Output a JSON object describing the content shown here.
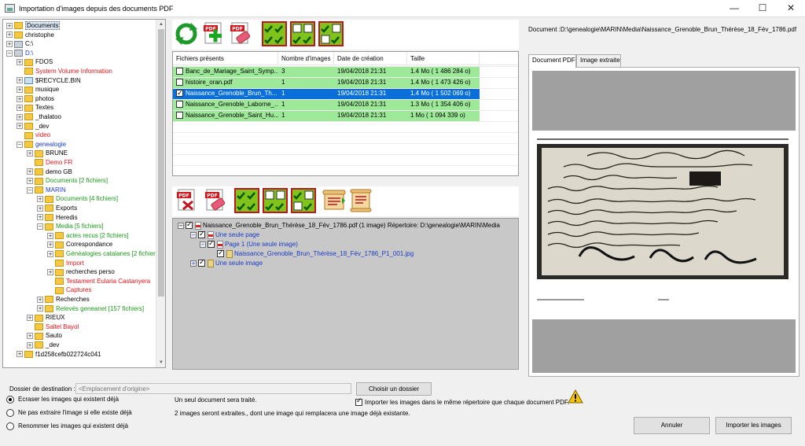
{
  "window": {
    "title": "Importation d'images depuis des documents PDF",
    "minimize": "—",
    "maximize": "☐",
    "close": "✕"
  },
  "tree": [
    {
      "label": "Documents",
      "level": 0,
      "expander": "+",
      "icon": "folder",
      "color": "black",
      "selected": true
    },
    {
      "label": "christophe",
      "level": 0,
      "expander": "+",
      "icon": "folder",
      "color": "black"
    },
    {
      "label": "C:\\",
      "level": 0,
      "expander": "+",
      "icon": "drive",
      "color": "black"
    },
    {
      "label": "D:\\",
      "level": 0,
      "expander": "−",
      "icon": "drive",
      "color": "blue"
    },
    {
      "label": "FDOS",
      "level": 1,
      "expander": "+",
      "icon": "folder",
      "color": "black"
    },
    {
      "label": "System Volume Information",
      "level": 1,
      "expander": "",
      "icon": "folder",
      "color": "red"
    },
    {
      "label": "$RECYCLE.BIN",
      "level": 1,
      "expander": "+",
      "icon": "recycle",
      "color": "black"
    },
    {
      "label": "musique",
      "level": 1,
      "expander": "+",
      "icon": "folder",
      "color": "black"
    },
    {
      "label": "photos",
      "level": 1,
      "expander": "+",
      "icon": "folder",
      "color": "black"
    },
    {
      "label": "Textes",
      "level": 1,
      "expander": "+",
      "icon": "folder",
      "color": "black"
    },
    {
      "label": "_thalatoo",
      "level": 1,
      "expander": "+",
      "icon": "folder",
      "color": "black"
    },
    {
      "label": "_dev",
      "level": 1,
      "expander": "+",
      "icon": "folder",
      "color": "black"
    },
    {
      "label": "video",
      "level": 1,
      "expander": "",
      "icon": "folder",
      "color": "red"
    },
    {
      "label": "genealogie",
      "level": 1,
      "expander": "−",
      "icon": "folder",
      "color": "blue"
    },
    {
      "label": "BRUNE",
      "level": 2,
      "expander": "+",
      "icon": "folder",
      "color": "black"
    },
    {
      "label": "Demo FR",
      "level": 2,
      "expander": "",
      "icon": "folder",
      "color": "red"
    },
    {
      "label": "demo GB",
      "level": 2,
      "expander": "+",
      "icon": "folder",
      "color": "black"
    },
    {
      "label": "Documents [2 fichiers]",
      "level": 2,
      "expander": "+",
      "icon": "folder",
      "color": "green"
    },
    {
      "label": "MARIN",
      "level": 2,
      "expander": "−",
      "icon": "folder",
      "color": "blue"
    },
    {
      "label": "Documents [4 fichiers]",
      "level": 3,
      "expander": "+",
      "icon": "folder",
      "color": "green"
    },
    {
      "label": "Exports",
      "level": 3,
      "expander": "+",
      "icon": "folder",
      "color": "black"
    },
    {
      "label": "Heredis",
      "level": 3,
      "expander": "+",
      "icon": "folder",
      "color": "black"
    },
    {
      "label": "Media [5 fichiers]",
      "level": 3,
      "expander": "−",
      "icon": "folder",
      "color": "green"
    },
    {
      "label": "actes recus [2 fichiers]",
      "level": 4,
      "expander": "+",
      "icon": "folder",
      "color": "green"
    },
    {
      "label": "Correspondance",
      "level": 4,
      "expander": "+",
      "icon": "folder",
      "color": "black"
    },
    {
      "label": "Généalogies catalanes [2 fichier",
      "level": 4,
      "expander": "+",
      "icon": "folder",
      "color": "green"
    },
    {
      "label": "Import",
      "level": 4,
      "expander": "",
      "icon": "folder",
      "color": "red"
    },
    {
      "label": "recherches perso",
      "level": 4,
      "expander": "+",
      "icon": "folder",
      "color": "black"
    },
    {
      "label": "Testament Eularia Castanyera",
      "level": 4,
      "expander": "",
      "icon": "folder",
      "color": "red"
    },
    {
      "label": "Captures",
      "level": 4,
      "expander": "",
      "icon": "folder",
      "color": "red"
    },
    {
      "label": "Recherches",
      "level": 3,
      "expander": "+",
      "icon": "folder",
      "color": "black"
    },
    {
      "label": "Relevés geneanet [157 fichiers]",
      "level": 3,
      "expander": "+",
      "icon": "folder",
      "color": "green"
    },
    {
      "label": "RIEUX",
      "level": 2,
      "expander": "+",
      "icon": "folder",
      "color": "black"
    },
    {
      "label": "Saltel Bayol",
      "level": 2,
      "expander": "",
      "icon": "folder",
      "color": "red"
    },
    {
      "label": "Sauto",
      "level": 2,
      "expander": "+",
      "icon": "folder",
      "color": "black"
    },
    {
      "label": "_dev",
      "level": 2,
      "expander": "+",
      "icon": "folder",
      "color": "black"
    },
    {
      "label": "f1d258cefb022724c041",
      "level": 1,
      "expander": "+",
      "icon": "folder",
      "color": "black"
    }
  ],
  "toolbar_top": [
    {
      "name": "refresh-icon"
    },
    {
      "name": "add-pdf-icon"
    },
    {
      "name": "pdf-eraser-icon"
    },
    {
      "name": "select-all-icon"
    },
    {
      "name": "select-none-icon"
    },
    {
      "name": "invert-selection-icon"
    }
  ],
  "toolbar_bottom": [
    {
      "name": "pdf-delete-icon"
    },
    {
      "name": "pdf-eraser-icon"
    },
    {
      "name": "select-all-icon"
    },
    {
      "name": "select-none-icon"
    },
    {
      "name": "invert-selection-icon"
    },
    {
      "name": "expand-scroll-icon"
    },
    {
      "name": "collapse-scroll-icon"
    }
  ],
  "files": {
    "headers": [
      "Fichiers présents",
      "Nombre d'images",
      "Date de création",
      "Taille"
    ],
    "rows": [
      {
        "name": "Banc_de_Mariage_Saint_Symp...",
        "count": "3",
        "date": "19/04/2018 21:31",
        "size": "1.4 Mo ( 1 486 284 o)",
        "checked": false,
        "state": "green"
      },
      {
        "name": "histoire_oran.pdf",
        "count": "1",
        "date": "19/04/2018 21:31",
        "size": "1.4 Mo ( 1 473 426 o)",
        "checked": false,
        "state": "green"
      },
      {
        "name": "Naissance_Grenoble_Brun_Th...",
        "count": "1",
        "date": "19/04/2018 21:31",
        "size": "1.4 Mo ( 1 502 069 o)",
        "checked": true,
        "state": "selected"
      },
      {
        "name": "Naissance_Grenoble_Laborne_...",
        "count": "1",
        "date": "19/04/2018 21:31",
        "size": "1.3 Mo ( 1 354 406 o)",
        "checked": false,
        "state": "green"
      },
      {
        "name": "Naissance_Grenoble_Saint_Hu...",
        "count": "1",
        "date": "19/04/2018 21:31",
        "size": "1 Mo ( 1 094 339 o)",
        "checked": false,
        "state": "green"
      }
    ]
  },
  "details": {
    "root": "Naissance_Grenoble_Brun_Thérèse_18_Fév_1786.pdf (1 image) Répertoire: D:\\genealogie\\MARIN\\Media",
    "node1": "Une seule page",
    "node2": "Page 1 (Une seule image)",
    "node3": "Naissance_Grenoble_Brun_Thérèse_18_Fév_1786_P1_001.jpg",
    "node4": "Une seule image"
  },
  "preview": {
    "document_label": "Document :D:\\genealogie\\MARIN\\Media\\Naissance_Grenoble_Brun_Thérèse_18_Fév_1786.pdf",
    "tab_pdf": "Document PDF",
    "tab_image": "Image extraite"
  },
  "bottom": {
    "dest_label": "Dossier de destination :",
    "dest_placeholder": "<Emplacement d'origine>",
    "choose_folder": "Choisir un dossier",
    "radio1": "Ecraser les images qui existent déjà",
    "radio2": "Ne pas extraire l'image si elle existe déjà",
    "radio3": "Renommer les images qui existent déjà",
    "info1": "Un seul document sera traité.",
    "info2": "2 images seront extraites., dont une image qui remplacera une image déjà existante.",
    "same_dir": "Importer les images dans le même répertoire que chaque document PDF.",
    "cancel": "Annuler",
    "import": "Importer les images"
  }
}
